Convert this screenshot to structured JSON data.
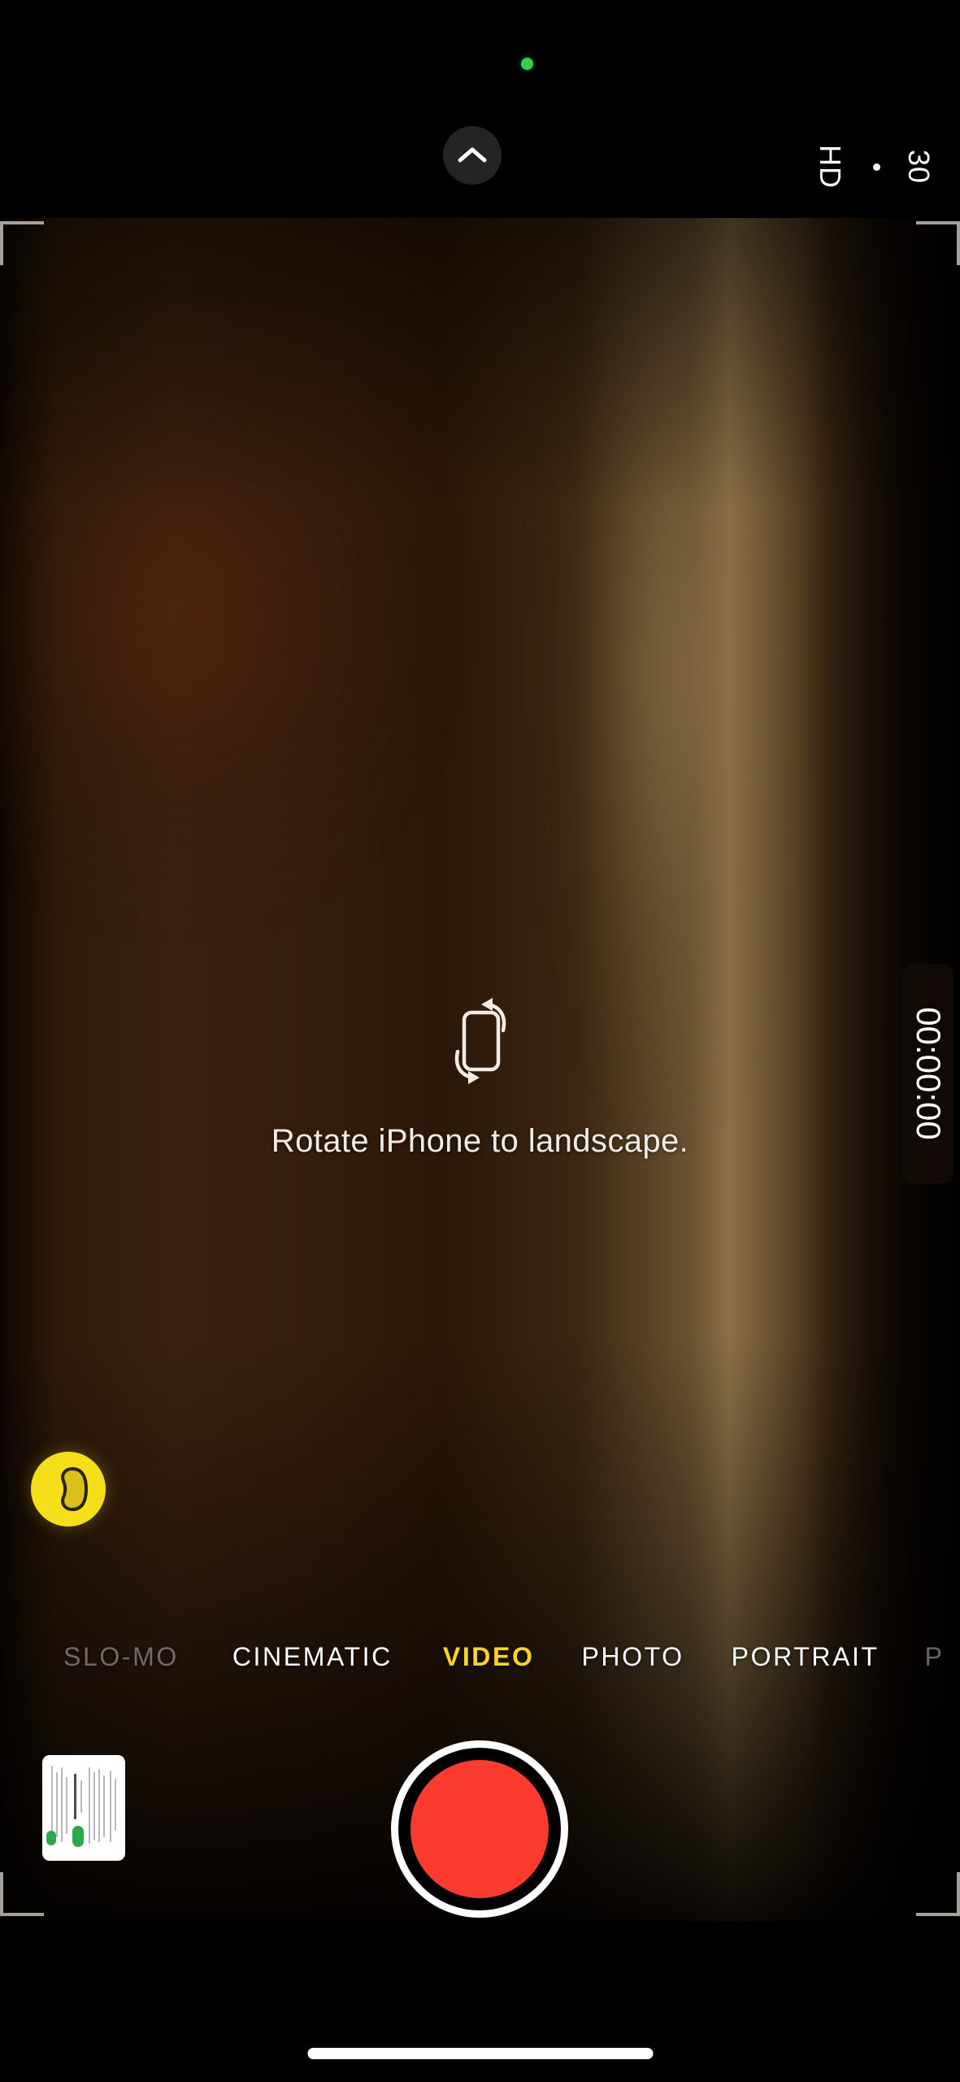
{
  "app": {
    "name": "Camera",
    "platform": "iOS"
  },
  "top_bar": {
    "recording_indicator": {
      "name": "camera-in-use-dot",
      "color": "#30D158"
    },
    "controls_toggle": {
      "icon": "chevron-up-icon",
      "label": ""
    },
    "quality": {
      "resolution_label": "HD",
      "separator": "·",
      "fps_label": "30"
    }
  },
  "viewfinder": {
    "rotate_hint": {
      "icon": "rotate-phone-icon",
      "text": "Rotate iPhone to landscape."
    },
    "timer": {
      "value": "00:00:00"
    },
    "subject_badge": {
      "icon": "subject-detect-icon",
      "color": "#F5DF1B"
    },
    "framing_corners": 4
  },
  "mode_selector": {
    "modes": [
      {
        "label": "SLO-MO",
        "state": "dim"
      },
      {
        "label": "CINEMATIC",
        "state": "normal"
      },
      {
        "label": "VIDEO",
        "state": "active"
      },
      {
        "label": "PHOTO",
        "state": "normal"
      },
      {
        "label": "PORTRAIT",
        "state": "normal"
      },
      {
        "label": "P",
        "state": "dim"
      }
    ],
    "selected": "VIDEO",
    "accent_color": "#FFD426"
  },
  "bottom_controls": {
    "thumbnail": {
      "name": "last-capture-thumbnail",
      "content": "document screenshot"
    },
    "shutter": {
      "name": "record-button",
      "state": "idle",
      "color": "#FB3B2E"
    }
  },
  "home_indicator": {
    "visible": true
  }
}
